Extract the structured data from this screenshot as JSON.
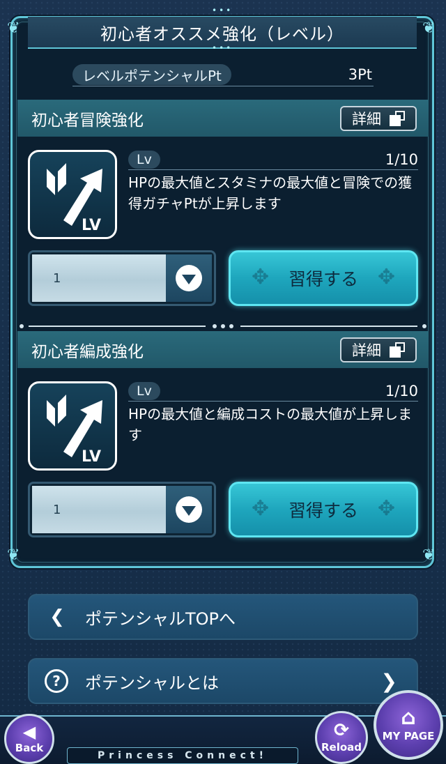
{
  "header": {
    "title": "初心者オススメ強化（レベル）"
  },
  "potential": {
    "label": "レベルポテンシャルPt",
    "value": "3Pt"
  },
  "skills": [
    {
      "title": "初心者冒険強化",
      "detail_label": "詳細",
      "lv_label": "Lv",
      "lv_count": "1/10",
      "description": "HPの最大値とスタミナの最大値と冒険での獲得ガチャPtが上昇します",
      "qty_value": "1",
      "acquire_label": "習得する"
    },
    {
      "title": "初心者編成強化",
      "detail_label": "詳細",
      "lv_label": "Lv",
      "lv_count": "1/10",
      "description": "HPの最大値と編成コストの最大値が上昇します",
      "qty_value": "1",
      "acquire_label": "習得する"
    }
  ],
  "icons": {
    "skill_icon": "level-up-arrow-icon",
    "skill_icon_text": "LV",
    "detail_icon": "open-window-icon",
    "dropdown_icon": "chevron-down-circle-icon",
    "back_nav_icon": "chevron-left-icon",
    "help_icon": "question-circle-icon",
    "forward_icon": "chevron-right-icon"
  },
  "nav": {
    "potential_top": "ポテンシャルTOPへ",
    "about_potential": "ポテンシャルとは"
  },
  "footer": {
    "back_label": "Back",
    "reload_label": "Reload",
    "mypage_label": "MY PAGE",
    "brand": "Princess Connect!"
  },
  "colors": {
    "accent_cyan": "#37c6d6",
    "section_teal": "#2a6a7b",
    "background": "#17304b",
    "footer_purple": "#5c3fae"
  }
}
